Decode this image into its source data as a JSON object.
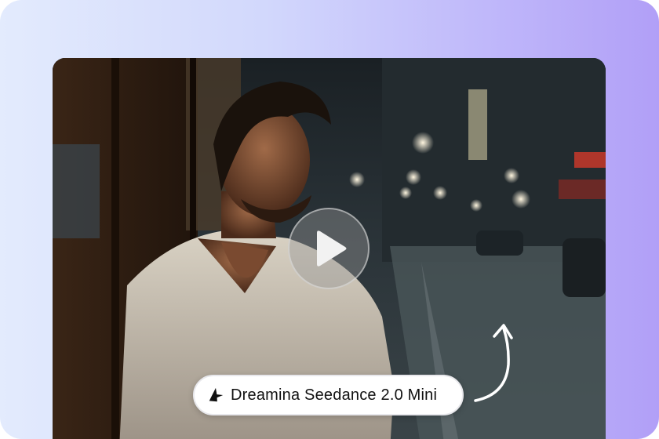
{
  "badge": {
    "icon": "dreamina-star-icon",
    "label": "Dreamina Seedance 2.0 Mini"
  },
  "video": {
    "play_icon": "play-icon",
    "scene": "thumbnail"
  },
  "colors": {
    "gradient_start": "#e3ebfd",
    "gradient_end": "#b19ff7",
    "badge_bg": "#ffffff",
    "arrow": "#ffffff"
  }
}
